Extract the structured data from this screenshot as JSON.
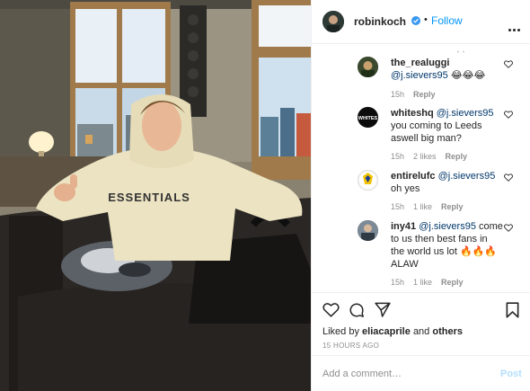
{
  "header": {
    "username": "robinkoch",
    "follow_label": "Follow",
    "separator": "•"
  },
  "comments": [
    {
      "user": "the_realuggi",
      "mention": "@j.sievers95",
      "text": "😂😂😂",
      "time": "15h",
      "likes": "",
      "reply_label": "Reply"
    },
    {
      "user": "whiteshq",
      "mention": "@j.sievers95",
      "text": "you coming to Leeds aswell big man?",
      "time": "15h",
      "likes": "2 likes",
      "reply_label": "Reply"
    },
    {
      "user": "entirelufc",
      "mention": "@j.sievers95",
      "text": "oh yes",
      "time": "15h",
      "likes": "1 like",
      "reply_label": "Reply"
    },
    {
      "user": "iny41",
      "mention": "@j.sievers95",
      "text": "come to us then best fans in the world us lot 🔥🔥🔥ALAW",
      "time": "15h",
      "likes": "1 like",
      "reply_label": "Reply"
    }
  ],
  "actions": {
    "liked_prefix": "Liked by",
    "liked_user": "eliacaprile",
    "liked_and": "and",
    "liked_others": "others",
    "time_ago": "15 HOURS AGO"
  },
  "add_comment": {
    "placeholder": "Add a comment…",
    "post_label": "Post"
  },
  "photo": {
    "hoodie_text": "ESSENTIALS"
  },
  "colors": {
    "link_blue": "#0095f6",
    "mention_blue": "#00376b",
    "meta_gray": "#8e8e8e",
    "hoodie_cream": "#ece3c2"
  }
}
